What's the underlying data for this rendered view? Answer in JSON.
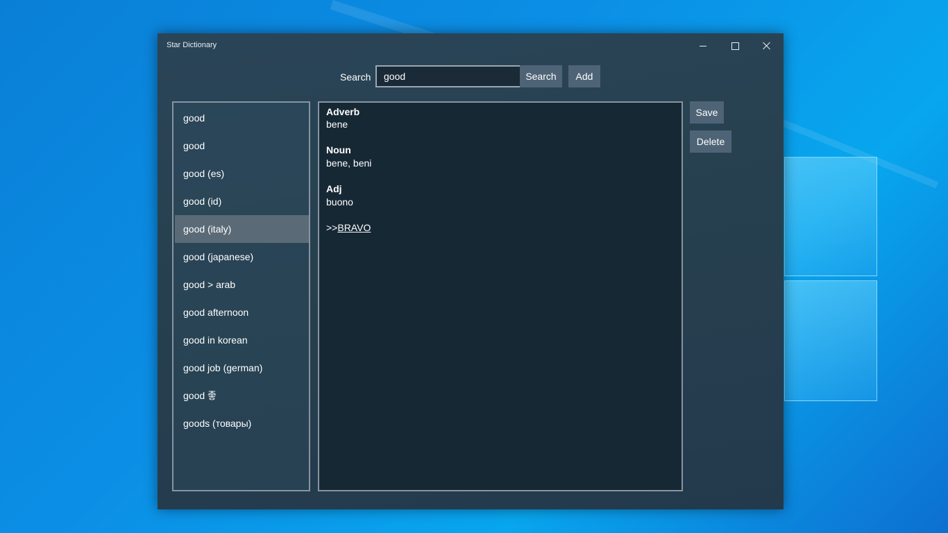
{
  "window": {
    "title": "Star Dictionary"
  },
  "search": {
    "label": "Search",
    "value": "good",
    "search_button": "Search",
    "add_button": "Add"
  },
  "actions": {
    "save_button": "Save",
    "delete_button": "Delete"
  },
  "word_list": {
    "selected_index": 4,
    "items": [
      "good",
      "good",
      "good (es)",
      "good (id)",
      "good (italy)",
      "good (japanese)",
      "good > arab",
      "good afternoon",
      "good in korean",
      "good job (german)",
      "good 좋",
      "goods (товары)"
    ]
  },
  "entry": {
    "sections": [
      {
        "pos": "Adverb",
        "definition": "bene"
      },
      {
        "pos": "Noun",
        "definition": "bene, beni"
      },
      {
        "pos": "Adj",
        "definition": "buono"
      }
    ],
    "ref_prefix": ">>",
    "ref_link": "BRAVO"
  },
  "colors": {
    "window_bg": "#27404f",
    "button_bg": "#4e6476",
    "selected_item_bg": "#5a6b77",
    "content_bg": "#172835",
    "desktop_bg": "#0b8fe6"
  }
}
